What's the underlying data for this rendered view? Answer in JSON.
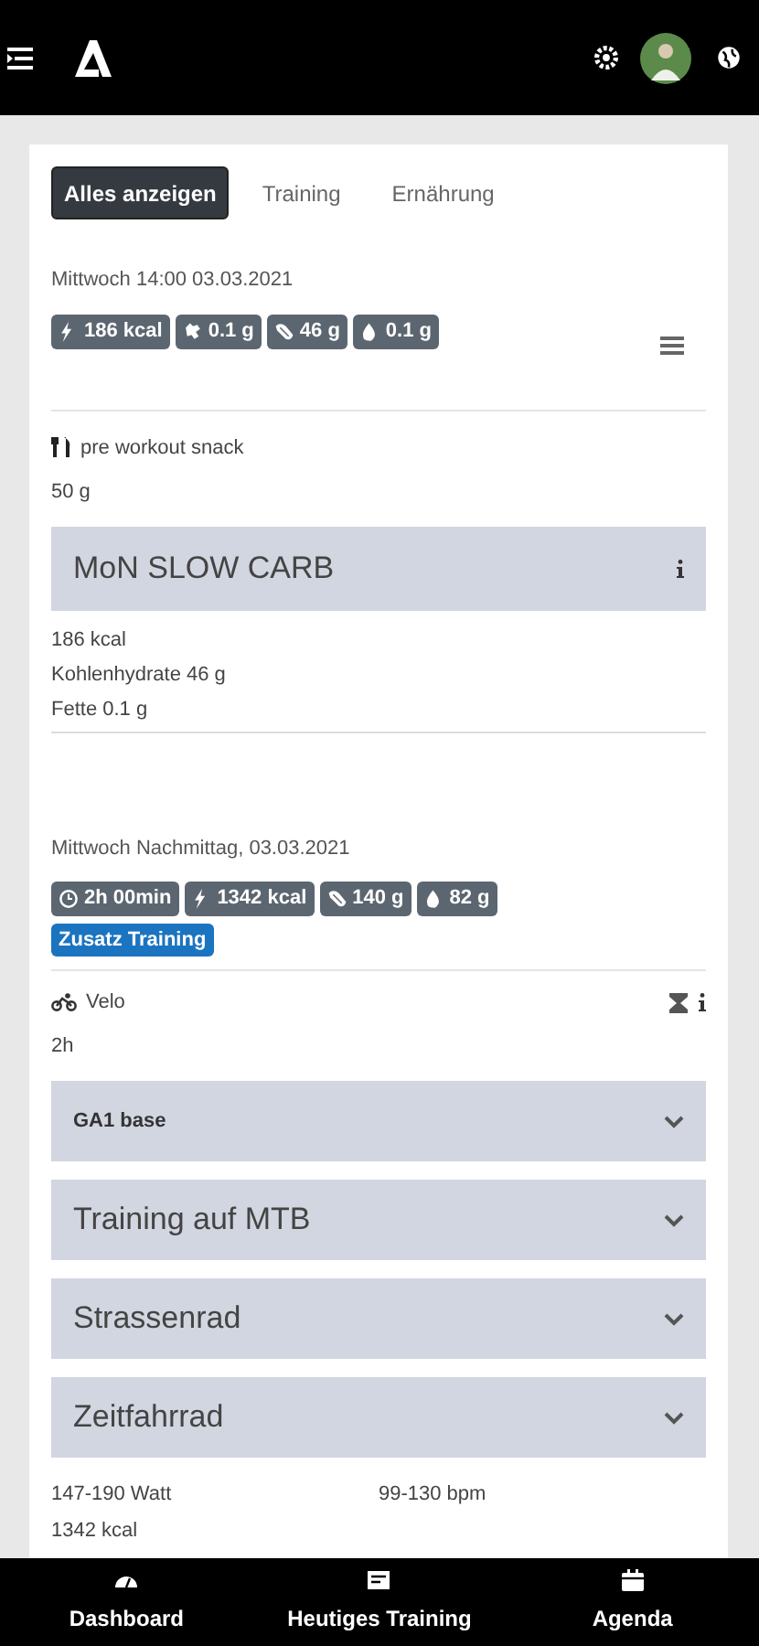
{
  "tabs": [
    {
      "label": "Alles anzeigen",
      "selected": true
    },
    {
      "label": "Training",
      "selected": false
    },
    {
      "label": "Ernährung",
      "selected": false
    }
  ],
  "meal": {
    "date": "Mittwoch 14:00 03.03.2021",
    "badges": [
      {
        "kind": "energy",
        "text": "186 kcal"
      },
      {
        "kind": "fat",
        "text": "0.1 g"
      },
      {
        "kind": "carbs",
        "text": "46 g"
      },
      {
        "kind": "drop",
        "text": "0.1 g"
      }
    ],
    "name": "pre workout snack",
    "amount": "50 g",
    "product": "MoN SLOW CARB",
    "details": [
      "186 kcal",
      "Kohlenhydrate 46 g",
      "Fette 0.1 g"
    ]
  },
  "training": {
    "date": "Mittwoch Nachmittag, 03.03.2021",
    "badges": [
      {
        "kind": "time",
        "text": "2h 00min"
      },
      {
        "kind": "energy",
        "text": "1342 kcal"
      },
      {
        "kind": "carbs",
        "text": "140 g"
      },
      {
        "kind": "drop",
        "text": "82 g"
      }
    ],
    "tag": "Zusatz Training",
    "sport": "Velo",
    "duration": "2h",
    "sections": [
      {
        "kind": "compact",
        "title": "GA1 base",
        "expanded": false
      },
      {
        "kind": "large",
        "title": "Training auf MTB",
        "expanded": false
      },
      {
        "kind": "large",
        "title": "Strassenrad",
        "expanded": false
      },
      {
        "kind": "large",
        "title": "Zeitfahrrad",
        "expanded": false
      }
    ],
    "power": "147-190 Watt",
    "heart_rate": "99-130 bpm",
    "energy": "1342 kcal"
  },
  "nav": [
    {
      "kind": "dashboard",
      "label": "Dashboard"
    },
    {
      "kind": "training",
      "label": "Heutiges Training"
    },
    {
      "kind": "agenda",
      "label": "Agenda"
    }
  ]
}
